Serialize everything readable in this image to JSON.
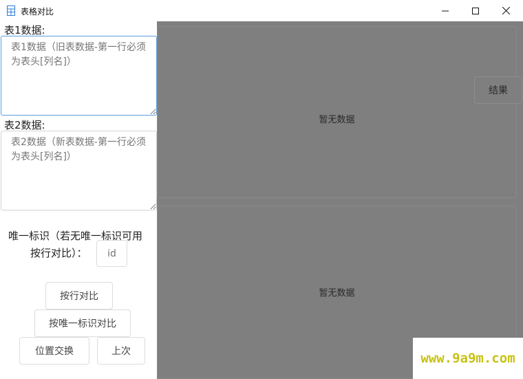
{
  "window": {
    "title": "表格对比",
    "icons": {
      "app": "table-icon",
      "minimize": "minimize-icon",
      "maximize": "maximize-icon",
      "close": "close-icon"
    }
  },
  "sidebar": {
    "table1_label": "表1数据:",
    "table1_placeholder": "表1数据（旧表数据-第一行必须为表头[列名]）",
    "table2_label": "表2数据:",
    "table2_placeholder": "表2数据（新表数据-第一行必须为表头[列名]）",
    "uid_label_line1": "唯一标识（若无唯一标识可用",
    "uid_label_line2": "按行对比）：",
    "uid_placeholder": "id",
    "buttons": {
      "compare_by_row": "按行对比",
      "compare_by_uid": "按唯一标识对比",
      "swap": "位置交换",
      "previous": "上次"
    }
  },
  "main": {
    "top_panel_empty": "暂无数据",
    "bottom_panel_empty": "暂无数据",
    "result_button": "结果"
  },
  "watermark": "www.9a9m.com",
  "colors": {
    "overlay": "#7f7f7f",
    "focus_border": "#5aa0df",
    "watermark": "#c7c212"
  }
}
